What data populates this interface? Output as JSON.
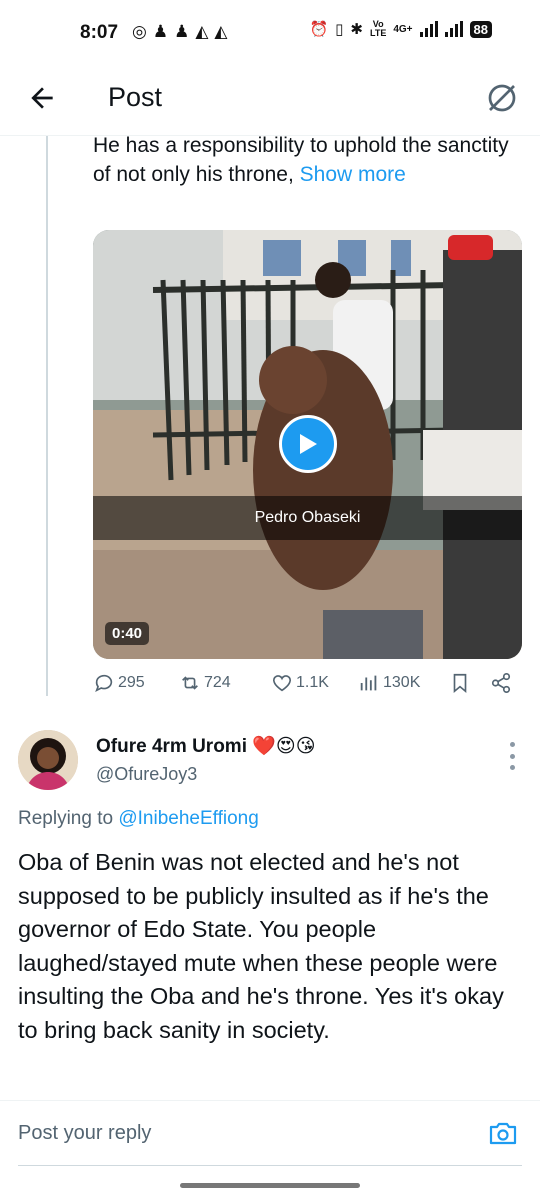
{
  "status_bar": {
    "time": "8:07",
    "left_icons": [
      "whatsapp-icon",
      "snapchat-icon",
      "snapchat-icon",
      "gamepad-icon",
      "gamepad-icon"
    ],
    "lte": "Vo\nLTE",
    "network": "4G+",
    "battery": "88"
  },
  "header": {
    "title": "Post"
  },
  "post": {
    "text": "He has a responsibility to uphold the sanctity of not only his throne, ",
    "show_more": "Show more",
    "video": {
      "caption": "Pedro Obaseki",
      "duration": "0:40"
    },
    "actions": {
      "replies": "295",
      "reposts": "724",
      "likes": "1.1K",
      "views": "130K"
    }
  },
  "reply": {
    "name": "Ofure 4rm Uromi ❤️😍😘",
    "handle": "@OfureJoy3",
    "replying_prefix": "Replying to ",
    "replying_to": "@InibeheEffiong",
    "text": "Oba of Benin was not elected and he's not supposed to be publicly insulted as if he's the governor of Edo State. You people laughed/stayed mute when these people were insulting the Oba and he's throne. Yes it's okay to bring back sanity in society."
  },
  "composer": {
    "placeholder": "Post your reply"
  },
  "colors": {
    "accent": "#1d9bf0",
    "text": "#0f1419",
    "secondary": "#536471",
    "heart": "#e0245e"
  }
}
